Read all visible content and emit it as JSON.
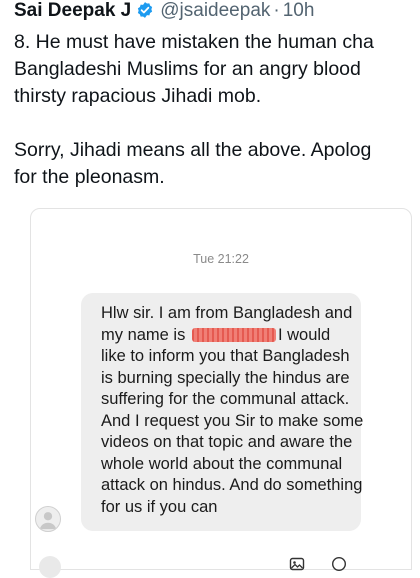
{
  "tweet": {
    "author_name": "Sai Deepak J",
    "handle": "@jsaideepak",
    "separator": "·",
    "time": "10h",
    "lines": [
      "8. He must have mistaken the human cha",
      "Bangladeshi Muslims for an angry blood",
      "thirsty rapacious Jihadi mob.",
      "",
      "Sorry, Jihadi means all the above. Apolog",
      "for the pleonasm."
    ]
  },
  "screenshot": {
    "message_time": "Tue 21:22",
    "message": {
      "line1": "Hlw sir. I am from Bangladesh and",
      "line2_before": "my name is",
      "line2_after": "I would",
      "line3": "like to inform you that Bangladesh",
      "line4": "is burning specially the hindus are",
      "line5": "suffering for the communal attack.",
      "line6": "And I request you Sir to make some",
      "line7": "videos on that topic and aware the",
      "line8": "whole world about the communal",
      "line9": "attack on hindus. And do something",
      "line10": "for us if you can"
    }
  },
  "colors": {
    "verified": "#1d9bf0",
    "secondary_text": "#536471",
    "bubble": "#eeeeee",
    "redaction": "#f07f76"
  },
  "icons": [
    "verified-badge-icon",
    "avatar-placeholder-icon",
    "camera-icon",
    "image-icon"
  ]
}
